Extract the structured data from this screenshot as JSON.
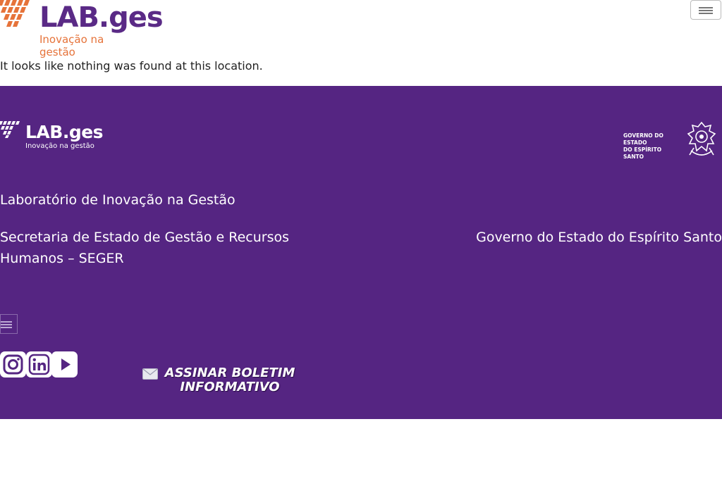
{
  "header": {
    "logo_text": "LAB.ges",
    "logo_tagline": "Inovação na gestão",
    "menu_toggle_icon": "hamburger-icon"
  },
  "main": {
    "not_found_message": "It looks like nothing was found at this location."
  },
  "footer": {
    "logo_text": "LAB.ges",
    "logo_tagline": "Inovação na gestão",
    "gov_logo_line1": "GOVERNO DO ESTADO",
    "gov_logo_line2": "DO ESPÍRITO SANTO",
    "lab_name": "Laboratório de Inovação na Gestão",
    "secretariat": "Secretaria de Estado de Gestão e Recursos Humanos – SEGER",
    "government": "Governo do Estado do Espírito Santo",
    "social": [
      {
        "icon": "instagram-icon"
      },
      {
        "icon": "linkedin-icon"
      },
      {
        "icon": "youtube-icon"
      }
    ],
    "newsletter_label": "ASSINAR BOLETIM INFORMATIVO",
    "newsletter_icon": "envelope-icon"
  },
  "colors": {
    "brand_purple": "#552582",
    "brand_orange": "#e6733a",
    "logo_purple": "#5a2a86"
  }
}
